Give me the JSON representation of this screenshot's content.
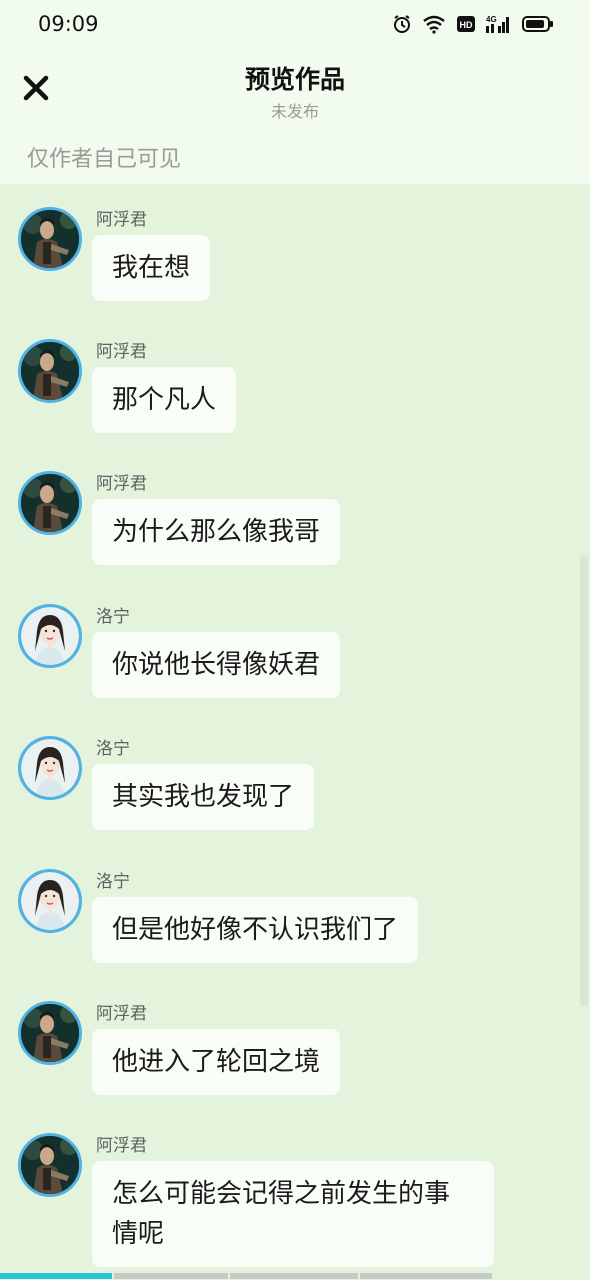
{
  "status_bar": {
    "time": "09:09",
    "icons": [
      "alarm-icon",
      "wifi-icon",
      "hd-icon",
      "signal-4g-icon",
      "battery-icon"
    ]
  },
  "header": {
    "close_icon": "close-icon",
    "title": "预览作品",
    "subtitle": "未发布",
    "visibility_note": "仅作者自己可见"
  },
  "messages": [
    {
      "speaker": "阿浮君",
      "avatar": "male-avatar",
      "text": "我在想"
    },
    {
      "speaker": "阿浮君",
      "avatar": "male-avatar",
      "text": "那个凡人"
    },
    {
      "speaker": "阿浮君",
      "avatar": "male-avatar",
      "text": "为什么那么像我哥"
    },
    {
      "speaker": "洛宁",
      "avatar": "female-avatar",
      "text": "你说他长得像妖君"
    },
    {
      "speaker": "洛宁",
      "avatar": "female-avatar",
      "text": "其实我也发现了"
    },
    {
      "speaker": "洛宁",
      "avatar": "female-avatar",
      "text": "但是他好像不认识我们了"
    },
    {
      "speaker": "阿浮君",
      "avatar": "male-avatar",
      "text": "他进入了轮回之境"
    },
    {
      "speaker": "阿浮君",
      "avatar": "male-avatar",
      "text": "怎么可能会记得之前发生的事情呢"
    }
  ],
  "colors": {
    "accent": "#4fb3e6",
    "progress": "#29c3d8",
    "background": "#e4f3dc",
    "bubble": "#f9fdf7"
  },
  "progress": {
    "segments": 4,
    "current_segment_fill": 1.0
  }
}
